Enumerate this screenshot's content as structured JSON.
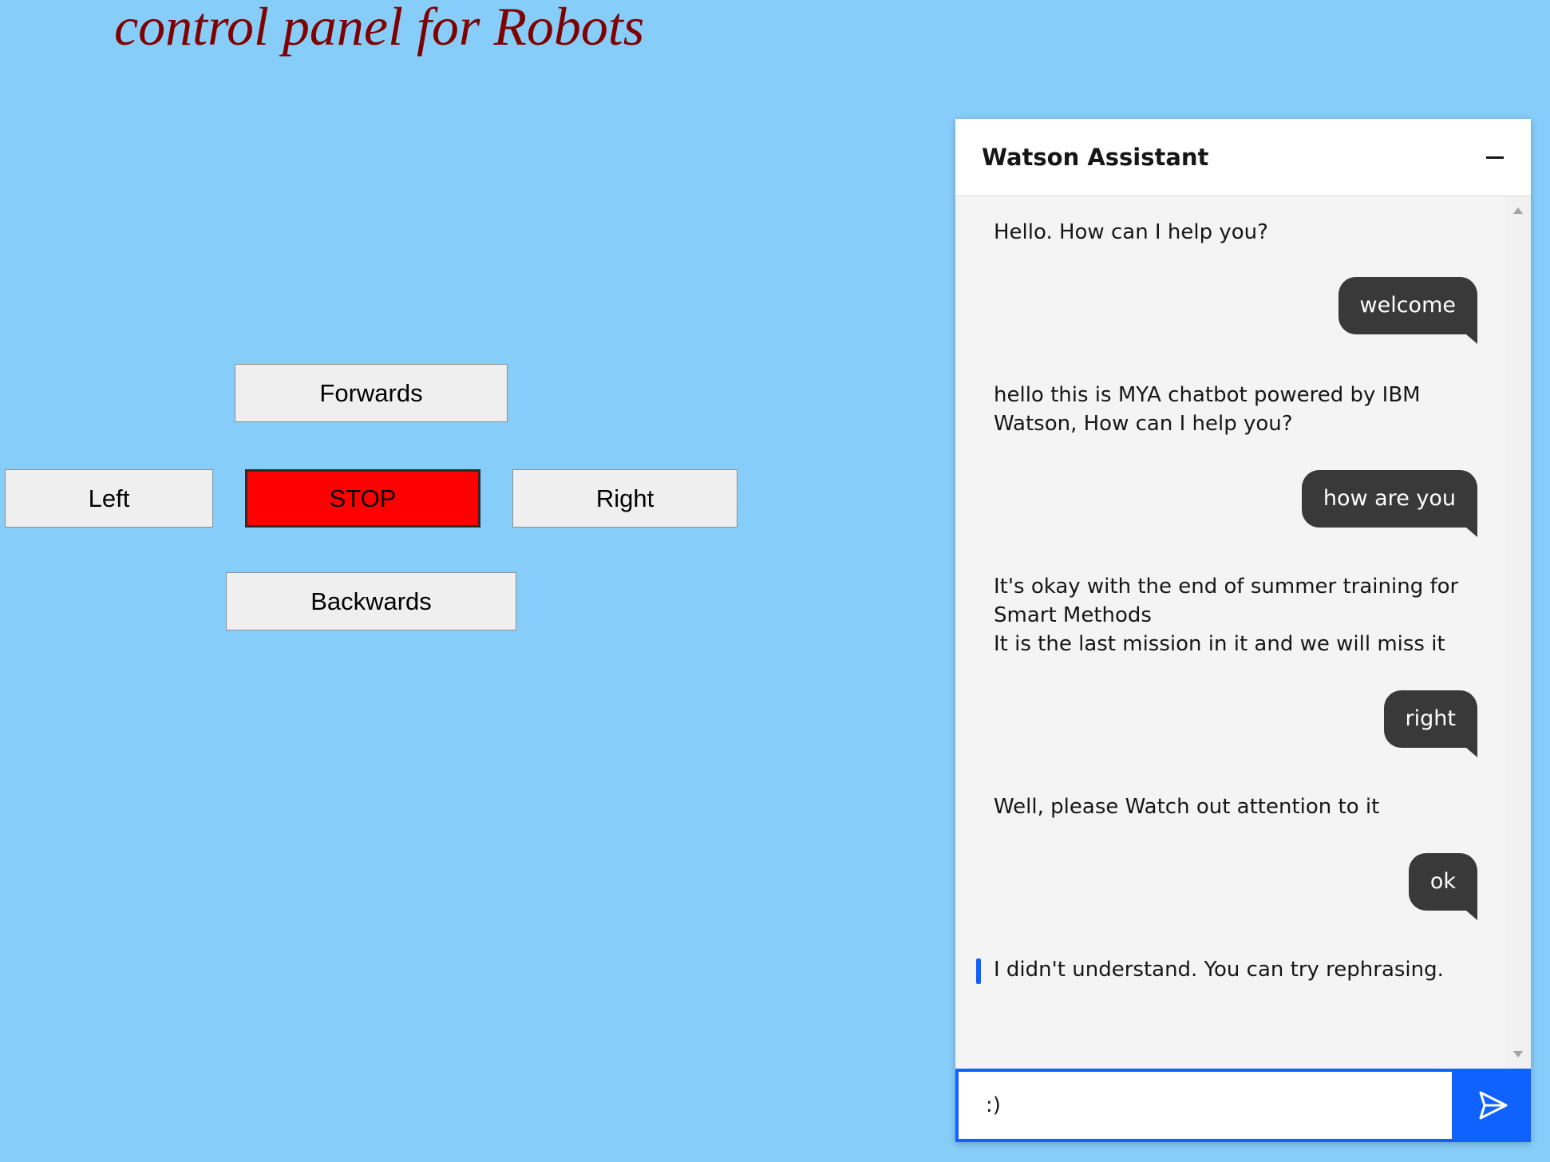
{
  "page": {
    "title": "control panel for Robots"
  },
  "controls": {
    "forwards": "Forwards",
    "left": "Left",
    "stop": "STOP",
    "right": "Right",
    "backwards": "Backwards"
  },
  "chat": {
    "title": "Watson Assistant",
    "minimize_icon": "minimize-icon",
    "messages": [
      {
        "from": "bot",
        "lines": [
          "Hello. How can I help you?"
        ]
      },
      {
        "from": "user",
        "text": "welcome"
      },
      {
        "from": "bot",
        "lines": [
          "hello this is MYA chatbot powered by IBM",
          "Watson, How can I help you?"
        ]
      },
      {
        "from": "user",
        "text": "how are you"
      },
      {
        "from": "bot",
        "lines": [
          "It's okay with the end of summer training for",
          "Smart Methods",
          "It is the last mission in it and we will miss it"
        ]
      },
      {
        "from": "user",
        "text": "right"
      },
      {
        "from": "bot",
        "lines": [
          "Well, please Watch out attention to it"
        ]
      },
      {
        "from": "user",
        "text": "ok"
      },
      {
        "from": "bot",
        "lines": [
          "I didn't understand. You can try rephrasing."
        ]
      }
    ],
    "input_value": ":)",
    "send_icon": "send-icon",
    "colors": {
      "accent": "#0f62fe",
      "user_bubble": "#393939"
    }
  },
  "colors": {
    "background": "#87cdf9",
    "title": "#800000",
    "stop": "#ff0000"
  }
}
